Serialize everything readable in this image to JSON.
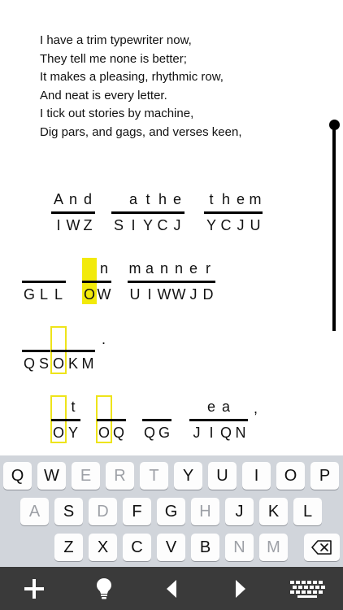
{
  "poem": {
    "lines": [
      "I have a trim typewriter now,",
      "They tell me none is better;",
      "It makes a pleasing, rhythmic row,",
      "And neat is every letter.",
      "I tick out stories by machine,",
      "Dig pars, and gags, and verses keen,"
    ]
  },
  "puzzle": {
    "cells": [
      {
        "guess": "A",
        "cipher": "I"
      },
      {
        "guess": "n",
        "cipher": "W"
      },
      {
        "guess": "d",
        "cipher": "Z"
      },
      {
        "guess": "",
        "cipher": "S"
      },
      {
        "guess": "a",
        "cipher": "I"
      },
      {
        "guess": "t",
        "cipher": "Y"
      },
      {
        "guess": "h",
        "cipher": "C"
      },
      {
        "guess": "e",
        "cipher": "J"
      },
      {
        "guess": "t",
        "cipher": "Y"
      },
      {
        "guess": "h",
        "cipher": "C"
      },
      {
        "guess": "e",
        "cipher": "J"
      },
      {
        "guess": "m",
        "cipher": "U"
      },
      {
        "guess": "",
        "cipher": "G"
      },
      {
        "guess": "",
        "cipher": "L"
      },
      {
        "guess": "",
        "cipher": "L"
      },
      {
        "guess": "",
        "cipher": "O"
      },
      {
        "guess": "n",
        "cipher": "W"
      },
      {
        "guess": "m",
        "cipher": "U"
      },
      {
        "guess": "a",
        "cipher": "I"
      },
      {
        "guess": "n",
        "cipher": "W"
      },
      {
        "guess": "n",
        "cipher": "W"
      },
      {
        "guess": "e",
        "cipher": "J"
      },
      {
        "guess": "r",
        "cipher": "D"
      },
      {
        "guess": "",
        "cipher": "Q"
      },
      {
        "guess": "",
        "cipher": "S"
      },
      {
        "guess": "",
        "cipher": "O"
      },
      {
        "guess": "",
        "cipher": "K"
      },
      {
        "guess": "",
        "cipher": "M"
      },
      {
        "guess": "",
        "cipher": "O"
      },
      {
        "guess": "t",
        "cipher": "Y"
      },
      {
        "guess": "",
        "cipher": "O"
      },
      {
        "guess": "",
        "cipher": "Q"
      },
      {
        "guess": "",
        "cipher": "Q"
      },
      {
        "guess": "",
        "cipher": "G"
      },
      {
        "guess": "",
        "cipher": "J"
      },
      {
        "guess": "e",
        "cipher": "I"
      },
      {
        "guess": "a",
        "cipher": "Q"
      },
      {
        "guess": "",
        "cipher": "N"
      }
    ],
    "punctuation": [
      ".",
      ","
    ]
  },
  "keyboard": {
    "row1": [
      "Q",
      "W",
      "E",
      "R",
      "T",
      "Y",
      "U",
      "I",
      "O",
      "P"
    ],
    "row2": [
      "A",
      "S",
      "D",
      "F",
      "G",
      "H",
      "J",
      "K",
      "L"
    ],
    "row3": [
      "Z",
      "X",
      "C",
      "V",
      "B",
      "N",
      "M"
    ],
    "delete_icon": "backspace-icon"
  },
  "toolbar": {
    "icons": [
      "plus-icon",
      "lightbulb-icon",
      "arrow-left-icon",
      "arrow-right-icon",
      "keyboard-icon"
    ]
  },
  "colors": {
    "highlight": "#f2ea0a",
    "keyboard_bg": "#d1d5db",
    "toolbar_bg": "#3a3a3a"
  }
}
